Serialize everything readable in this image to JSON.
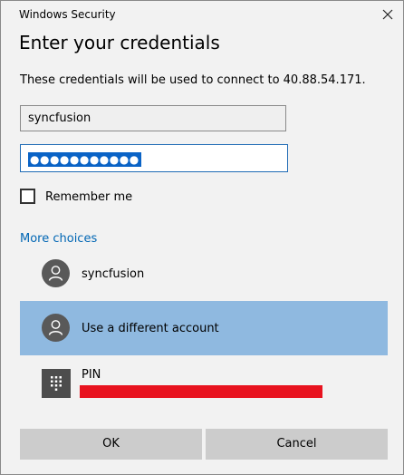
{
  "window": {
    "title": "Windows Security",
    "heading": "Enter your credentials",
    "description": "These credentials will be used to connect to 40.88.54.171."
  },
  "form": {
    "username_value": "syncfusion",
    "password_masked": "●●●●●●●●●●●",
    "remember_label": "Remember me",
    "remember_checked": false
  },
  "more_choices": {
    "link_label": "More choices",
    "options": [
      {
        "label": "syncfusion",
        "icon": "user-avatar-icon",
        "selected": false
      },
      {
        "label": "Use a different account",
        "icon": "user-avatar-icon",
        "selected": true
      },
      {
        "label": "PIN",
        "icon": "pin-keypad-icon",
        "selected": false
      }
    ]
  },
  "buttons": {
    "ok": "OK",
    "cancel": "Cancel"
  },
  "colors": {
    "background": "#f2f2f2",
    "link": "#0066b4",
    "selected_option": "#8fb9e0",
    "password_border": "#1f6bb5",
    "selection_highlight": "#0a63c6",
    "redaction": "#e8131f",
    "button": "#cccccc"
  }
}
